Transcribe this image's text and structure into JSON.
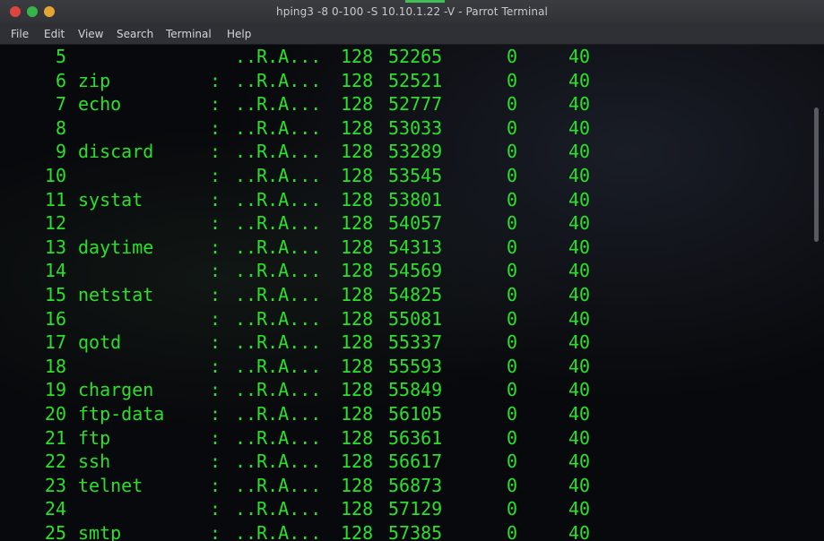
{
  "window": {
    "title": "hping3 -8 0-100 -S 10.10.1.22 -V - Parrot Terminal"
  },
  "menu": {
    "items": [
      "File",
      "Edit",
      "View",
      "Search",
      "Terminal",
      "Help"
    ]
  },
  "colors": {
    "terminal_text": "#2be02b",
    "terminal_bg": "#08090c",
    "close_button": "#e0443e",
    "minimize_button": "#36b44a",
    "maximize_button": "#e5a631"
  },
  "terminal": {
    "rows": [
      {
        "port": "5",
        "name": "",
        "colon": "",
        "flags": "..R.A...",
        "ttl": "128",
        "id": "52265",
        "win": "0",
        "len": "40"
      },
      {
        "port": "6",
        "name": "zip",
        "colon": ":",
        "flags": "..R.A...",
        "ttl": "128",
        "id": "52521",
        "win": "0",
        "len": "40"
      },
      {
        "port": "7",
        "name": "echo",
        "colon": ":",
        "flags": "..R.A...",
        "ttl": "128",
        "id": "52777",
        "win": "0",
        "len": "40"
      },
      {
        "port": "8",
        "name": "",
        "colon": ":",
        "flags": "..R.A...",
        "ttl": "128",
        "id": "53033",
        "win": "0",
        "len": "40"
      },
      {
        "port": "9",
        "name": "discard",
        "colon": ":",
        "flags": "..R.A...",
        "ttl": "128",
        "id": "53289",
        "win": "0",
        "len": "40"
      },
      {
        "port": "10",
        "name": "",
        "colon": ":",
        "flags": "..R.A...",
        "ttl": "128",
        "id": "53545",
        "win": "0",
        "len": "40"
      },
      {
        "port": "11",
        "name": "systat",
        "colon": ":",
        "flags": "..R.A...",
        "ttl": "128",
        "id": "53801",
        "win": "0",
        "len": "40"
      },
      {
        "port": "12",
        "name": "",
        "colon": ":",
        "flags": "..R.A...",
        "ttl": "128",
        "id": "54057",
        "win": "0",
        "len": "40"
      },
      {
        "port": "13",
        "name": "daytime",
        "colon": ":",
        "flags": "..R.A...",
        "ttl": "128",
        "id": "54313",
        "win": "0",
        "len": "40"
      },
      {
        "port": "14",
        "name": "",
        "colon": ":",
        "flags": "..R.A...",
        "ttl": "128",
        "id": "54569",
        "win": "0",
        "len": "40"
      },
      {
        "port": "15",
        "name": "netstat",
        "colon": ":",
        "flags": "..R.A...",
        "ttl": "128",
        "id": "54825",
        "win": "0",
        "len": "40"
      },
      {
        "port": "16",
        "name": "",
        "colon": ":",
        "flags": "..R.A...",
        "ttl": "128",
        "id": "55081",
        "win": "0",
        "len": "40"
      },
      {
        "port": "17",
        "name": "qotd",
        "colon": ":",
        "flags": "..R.A...",
        "ttl": "128",
        "id": "55337",
        "win": "0",
        "len": "40"
      },
      {
        "port": "18",
        "name": "",
        "colon": ":",
        "flags": "..R.A...",
        "ttl": "128",
        "id": "55593",
        "win": "0",
        "len": "40"
      },
      {
        "port": "19",
        "name": "chargen",
        "colon": ":",
        "flags": "..R.A...",
        "ttl": "128",
        "id": "55849",
        "win": "0",
        "len": "40"
      },
      {
        "port": "20",
        "name": "ftp-data",
        "colon": ":",
        "flags": "..R.A...",
        "ttl": "128",
        "id": "56105",
        "win": "0",
        "len": "40"
      },
      {
        "port": "21",
        "name": "ftp",
        "colon": ":",
        "flags": "..R.A...",
        "ttl": "128",
        "id": "56361",
        "win": "0",
        "len": "40"
      },
      {
        "port": "22",
        "name": "ssh",
        "colon": ":",
        "flags": "..R.A...",
        "ttl": "128",
        "id": "56617",
        "win": "0",
        "len": "40"
      },
      {
        "port": "23",
        "name": "telnet",
        "colon": ":",
        "flags": "..R.A...",
        "ttl": "128",
        "id": "56873",
        "win": "0",
        "len": "40"
      },
      {
        "port": "24",
        "name": "",
        "colon": ":",
        "flags": "..R.A...",
        "ttl": "128",
        "id": "57129",
        "win": "0",
        "len": "40"
      },
      {
        "port": "25",
        "name": "smtp",
        "colon": ":",
        "flags": "..R.A...",
        "ttl": "128",
        "id": "57385",
        "win": "0",
        "len": "40"
      }
    ]
  }
}
